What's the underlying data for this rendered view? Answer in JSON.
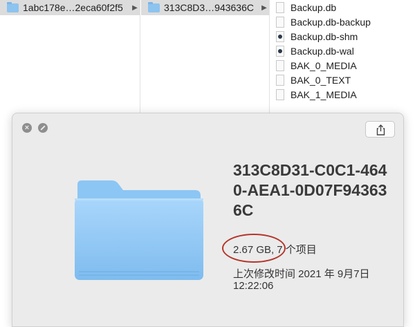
{
  "finder": {
    "column1": {
      "selected_folder": "1abc178e…2eca60f2f5"
    },
    "column2": {
      "selected_folder": "313C8D3…943636C"
    },
    "column3": {
      "files": [
        {
          "name": "Backup.db",
          "icon": "document-icon"
        },
        {
          "name": "Backup.db-backup",
          "icon": "document-icon"
        },
        {
          "name": "Backup.db-shm",
          "icon": "executable-icon"
        },
        {
          "name": "Backup.db-wal",
          "icon": "executable-icon"
        },
        {
          "name": "BAK_0_MEDIA",
          "icon": "document-icon"
        },
        {
          "name": "BAK_0_TEXT",
          "icon": "document-icon"
        },
        {
          "name": "BAK_1_MEDIA",
          "icon": "document-icon"
        }
      ]
    }
  },
  "info_panel": {
    "title": "313C8D31-C0C1-4640-AEA1-0D07F943636C",
    "size": "2.67 GB",
    "separator": ",",
    "item_count": "7 个项目",
    "modified_label": "上次修改时间 2021 年 9月7日",
    "modified_time": "12:22:06",
    "share_icon": "share-icon",
    "highlight_color": "#b5352a"
  }
}
